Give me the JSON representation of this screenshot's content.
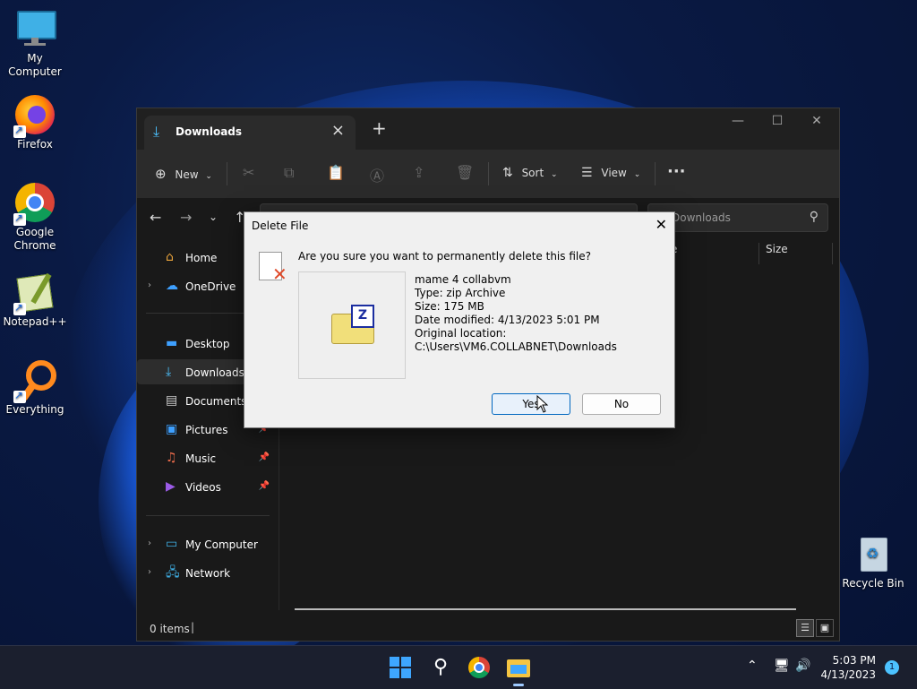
{
  "desktop": {
    "icons": [
      {
        "label": "My Computer"
      },
      {
        "label": "Firefox"
      },
      {
        "label": "Google Chrome"
      },
      {
        "label": "Notepad++"
      },
      {
        "label": "Everything"
      },
      {
        "label": "Recycle Bin"
      }
    ]
  },
  "explorer": {
    "tab_title": "Downloads",
    "toolbar": {
      "new_label": "New",
      "sort_label": "Sort",
      "view_label": "View"
    },
    "search_placeholder": "Search Downloads",
    "search_visible": "ch Downloads",
    "columns": {
      "type_partial": "e",
      "size": "Size"
    },
    "sidebar": {
      "home": "Home",
      "onedrive": "OneDrive",
      "desktop": "Desktop",
      "downloads": "Downloads",
      "documents": "Documents",
      "pictures": "Pictures",
      "music": "Music",
      "videos": "Videos",
      "mycomputer": "My Computer",
      "network": "Network"
    },
    "status": "0 items"
  },
  "dialog": {
    "title": "Delete File",
    "question": "Are you sure you want to permanently delete this file?",
    "file_name": "mame 4 collabvm",
    "file_type": "Type: zip Archive",
    "file_size": "Size: 175 MB",
    "date_modified": "Date modified: 4/13/2023 5:01 PM",
    "original_location_label": "Original location:",
    "original_location_path": "C:\\Users\\VM6.COLLABNET\\Downloads",
    "yes": "Yes",
    "no": "No"
  },
  "taskbar": {
    "time": "5:03 PM",
    "date": "4/13/2023",
    "notifications": "1"
  }
}
